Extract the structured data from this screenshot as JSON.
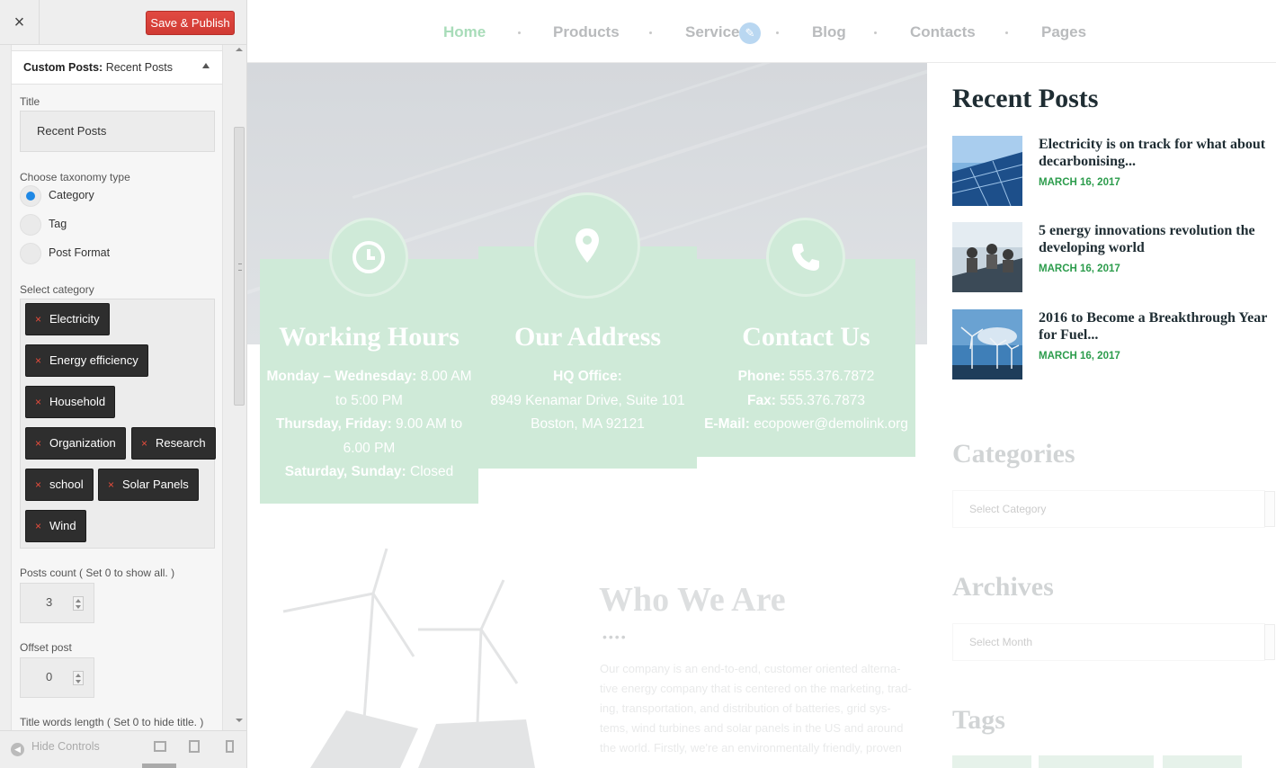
{
  "customizer": {
    "close_label": "×",
    "save_label": "Save & Publish",
    "section_prefix": "Custom Posts:",
    "section_name": "Recent Posts",
    "title_label": "Title",
    "title_value": "Recent Posts",
    "taxonomy_label": "Choose taxonomy type",
    "taxonomy_options": [
      {
        "label": "Category",
        "selected": true
      },
      {
        "label": "Tag",
        "selected": false
      },
      {
        "label": "Post Format",
        "selected": false
      }
    ],
    "category_label": "Select category",
    "categories": [
      "Electricity",
      "Energy efficiency",
      "Household",
      "Organization",
      "Research",
      "school",
      "Solar Panels",
      "Wind"
    ],
    "posts_count_label": "Posts count ( Set 0 to show all. )",
    "posts_count_value": "3",
    "offset_label": "Offset post",
    "offset_value": "0",
    "title_words_label": "Title words length ( Set 0 to hide title. )",
    "hide_controls_label": "Hide Controls",
    "accent_save": "#d9534f",
    "accent_radio": "#1e88e5"
  },
  "site": {
    "nav": [
      "Home",
      "Products",
      "Service",
      "Blog",
      "Contacts",
      "Pages"
    ],
    "nav_active": "Home",
    "cards": [
      {
        "title": "Working Hours",
        "icon": "clock-icon",
        "lines": [
          {
            "b": "Monday – Wednesday:",
            "t": " 8.00 AM"
          },
          {
            "b": "",
            "t": "to 5:00 PM"
          },
          {
            "b": "Thursday, Friday:",
            "t": " 9.00 AM to"
          },
          {
            "b": "",
            "t": "6.00 PM"
          },
          {
            "b": "Saturday, Sunday:",
            "t": " Closed"
          }
        ]
      },
      {
        "title": "Our Address",
        "icon": "map-pin-icon",
        "lines": [
          {
            "b": "HQ Office:",
            "t": ""
          },
          {
            "b": "",
            "t": "8949 Kenamar Drive, Suite 101"
          },
          {
            "b": "",
            "t": "Boston, MA 92121"
          }
        ]
      },
      {
        "title": "Contact Us",
        "icon": "phone-icon",
        "lines": [
          {
            "b": "Phone:",
            "t": " 555.376.7872"
          },
          {
            "b": "Fax:",
            "t": " 555.376.7873"
          },
          {
            "b": "E-Mail:",
            "t": " ecopower@demolink.org"
          }
        ]
      }
    ],
    "who_title": "Who We Are",
    "who_dots": "••••",
    "who_text": "Our company is an end-to-end, customer oriented alterna-tive energy company that is centered on the marketing, trad-ing, transportation, and distribution of batteries, grid sys-tems, wind turbines and solar panels in the US and around the world. Firstly, we're an environmentally friendly, proven",
    "recent_title": "Recent Posts",
    "recent_posts": [
      {
        "title": "Electricity is on track for what about decarbonising...",
        "date": "MARCH 16, 2017"
      },
      {
        "title": "5 energy innovations revolution the developing world",
        "date": "MARCH 16, 2017"
      },
      {
        "title": "2016 to Become a Breakthrough Year for Fuel...",
        "date": "MARCH 16, 2017"
      }
    ],
    "categories_title": "Categories",
    "categories_placeholder": "Select Category",
    "archives_title": "Archives",
    "archives_placeholder": "Select Month",
    "tags_title": "Tags",
    "card_color": "#cfead8",
    "date_color": "#2c9c4c"
  }
}
